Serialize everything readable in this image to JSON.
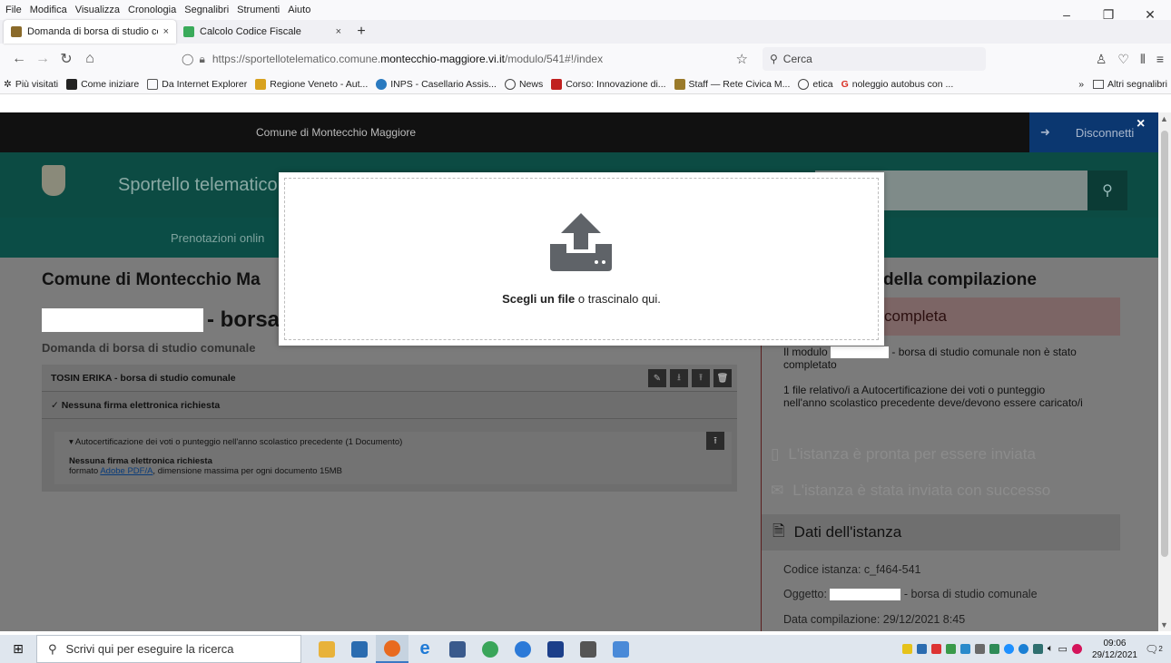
{
  "menubar": [
    "File",
    "Modifica",
    "Visualizza",
    "Cronologia",
    "Segnalibri",
    "Strumenti",
    "Aiuto"
  ],
  "window_controls": {
    "minimize": "–",
    "restore": "❐",
    "close": "✕"
  },
  "tabs": [
    {
      "label": "Domanda di borsa di studio co",
      "close": "×",
      "icon_color": "#8a6a2a"
    },
    {
      "label": "Calcolo Codice Fiscale",
      "close": "×",
      "icon_color": "#3aaa5a"
    }
  ],
  "new_tab": "+",
  "url": {
    "prefix": "https://sportellotelematico.comune.",
    "host": "montecchio-maggiore.vi.it",
    "path": "/modulo/541#!/index"
  },
  "search": {
    "placeholder": "Cerca"
  },
  "bookmarks": [
    {
      "label": "Più visitati",
      "icon": "gear-icon"
    },
    {
      "label": "Come iniziare",
      "icon": "m-icon"
    },
    {
      "label": "Da Internet Explorer",
      "icon": "folder-icon"
    },
    {
      "label": "Regione Veneto - Aut...",
      "icon": "flag-icon"
    },
    {
      "label": "INPS - Casellario Assis...",
      "icon": "inps-icon"
    },
    {
      "label": "News",
      "icon": "globe-icon"
    },
    {
      "label": "Corso: Innovazione di...",
      "icon": "shield-icon"
    },
    {
      "label": "Staff — Rete Civica M...",
      "icon": "stemma-icon"
    },
    {
      "label": "etica",
      "icon": "globe-icon"
    },
    {
      "label": "noleggio autobus con ...",
      "icon": "google-icon"
    }
  ],
  "bookmarks_more": "»",
  "bookmarks_other": "Altri segnalibri",
  "site": {
    "comune_bar": "Comune di Montecchio Maggiore",
    "logout": "Disconnetti",
    "portal_title": "Sportello telematico p",
    "nav_item": "Prenotazioni onlin",
    "page_heading": "Comune di Montecchio Ma",
    "form_title": "- borsa",
    "form_subtitle": "Domanda di borsa di studio comunale",
    "form_box": {
      "header": "TOSIN ERIKA - borsa di studio comunale",
      "signature": "✓ Nessuna firma elettronica richiesta",
      "attachment_title": "▾ Autocertificazione dei voti o punteggio nell'anno scolastico precedente (1 Documento)",
      "attachment_signature": "Nessuna firma elettronica richiesta",
      "attachment_format_prefix": "formato ",
      "attachment_format_link": "Adobe PDF/A",
      "attachment_format_suffix": ", dimensione massima per ogni documento 15MB"
    },
    "sidebar": {
      "title": "della compilazione",
      "status": "completa",
      "msg1_prefix": "Il modulo",
      "msg1_suffix": "- borsa di studio comunale non è stato completato",
      "msg2": "1 file relativo/i a Autocertificazione dei voti o punteggio nell'anno scolastico precedente deve/devono essere caricato/i",
      "step_ready": "L'istanza è pronta per essere inviata",
      "step_sent": "L'istanza è stata inviata con successo",
      "dati": "Dati dell'istanza",
      "codice": "Codice istanza: c_f464-541",
      "oggetto_prefix": "Oggetto:",
      "oggetto_suffix": "- borsa di studio comunale",
      "data": "Data compilazione: 29/12/2021 8:45"
    }
  },
  "modal": {
    "choose": "Scegli un file",
    "rest": " o trascinalo qui.",
    "close": "×"
  },
  "taskbar": {
    "search_placeholder": "Scrivi qui per eseguire la ricerca",
    "time": "09:06",
    "date": "29/12/2021",
    "notifications": "2",
    "apps": [
      {
        "name": "file-explorer-icon",
        "color": "#e8b23a"
      },
      {
        "name": "taskview-icon",
        "color": "#2b6cb0"
      },
      {
        "name": "firefox-icon",
        "color": "#e86a1f"
      },
      {
        "name": "ie-icon",
        "color": "#1f7ad6"
      },
      {
        "name": "calendar-icon",
        "color": "#3a5a8c"
      },
      {
        "name": "chrome-icon",
        "color": "#3aa55a"
      },
      {
        "name": "app-icon",
        "color": "#2c7ad8"
      },
      {
        "name": "windows-app-icon",
        "color": "#1c3f8a"
      },
      {
        "name": "printer-icon",
        "color": "#555555"
      },
      {
        "name": "image-app-icon",
        "color": "#4a8ad8"
      }
    ]
  }
}
